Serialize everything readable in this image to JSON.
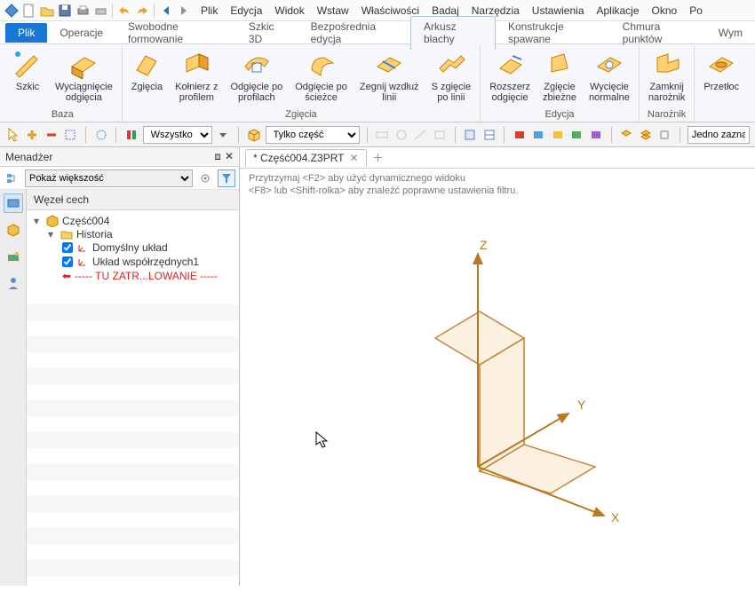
{
  "menubar": [
    "Plik",
    "Edycja",
    "Widok",
    "Wstaw",
    "Właściwości",
    "Badaj",
    "Narzędzia",
    "Ustawienia",
    "Aplikacje",
    "Okno",
    "Po"
  ],
  "ribbonTabs": {
    "file": "Plik",
    "items": [
      "Operacje",
      "Swobodne formowanie",
      "Szkic 3D",
      "Bezpośrednia edycja",
      "Arkusz blachy",
      "Konstrukcje spawane",
      "Chmura punktów",
      "Wym"
    ],
    "activeIndex": 4
  },
  "ribbonGroups": {
    "baza": {
      "label": "Baza",
      "buttons": [
        {
          "label": "Szkic"
        },
        {
          "label": "Wyciągnięcie\nodgięcia"
        }
      ]
    },
    "zgiecia": {
      "label": "Zgięcia",
      "buttons": [
        {
          "label": "Zgięcia"
        },
        {
          "label": "Kołnierz z\nprofilem"
        },
        {
          "label": "Odgięcie po\nprofilach"
        },
        {
          "label": "Odgięcie po\nścieżce"
        },
        {
          "label": "Zegnij wzdłuż\nlinii"
        },
        {
          "label": "S zgięcie\npo linii"
        }
      ]
    },
    "edycja": {
      "label": "Edycja",
      "buttons": [
        {
          "label": "Rozszerz\nodgięcie"
        },
        {
          "label": "Zgięcie\nzbieżne"
        },
        {
          "label": "Wycięcie\nnormalne"
        }
      ]
    },
    "naroznik": {
      "label": "Narożnik",
      "buttons": [
        {
          "label": "Zamknij\nnarożnik"
        }
      ]
    },
    "extra": {
      "label": "",
      "buttons": [
        {
          "label": "Przetłoc"
        }
      ]
    }
  },
  "toolbar2": {
    "selAll": "Wszystko",
    "selOnly": "Tylko część",
    "rightInput": "Jedno zaznac"
  },
  "manager": {
    "title": "Menadżer",
    "filterSel": "Pokaż większość",
    "treeTitle": "Węzeł cech",
    "root": "Część004",
    "history": "Historia",
    "nodes": {
      "n1": "Domyślny układ",
      "n2": "Układ współrzędnych1",
      "warn": "----- TU ZATR...LOWANIE -----"
    }
  },
  "docTab": {
    "name": "* Część004.Z3PRT"
  },
  "hints": {
    "l1": "Przytrzymaj <F2> aby użyć dynamicznego widoku",
    "l2": "<F8> lub <Shift-rolka> aby znaleźć poprawne ustawienia filtru."
  },
  "axes": {
    "x": "X",
    "y": "Y",
    "z": "Z"
  }
}
